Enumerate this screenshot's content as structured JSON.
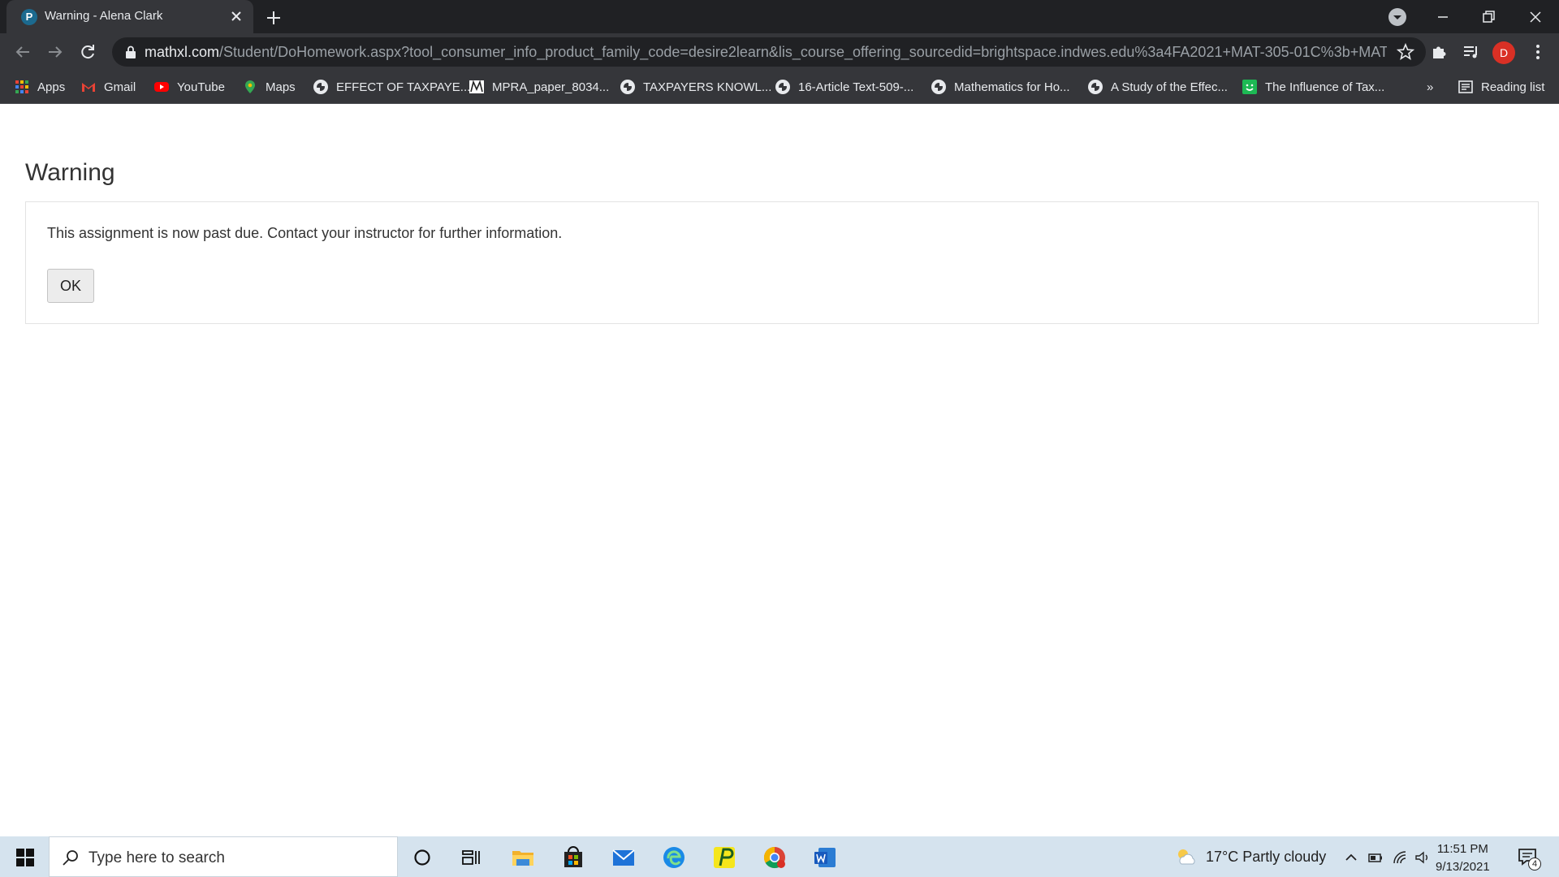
{
  "browser": {
    "tab": {
      "title": "Warning - Alena Clark",
      "favicon_letter": "P"
    },
    "url": {
      "host": "mathxl.com",
      "path": "/Student/DoHomework.aspx?tool_consumer_info_product_family_code=desire2learn&lis_course_offering_sourcedid=brightspace.indwes.edu%3a4FA2021+MAT-305-01C%3b+MAT-305..."
    },
    "profile_initial": "D",
    "bookmarks": [
      {
        "label": "Apps",
        "icon": "apps-grid-icon"
      },
      {
        "label": "Gmail",
        "icon": "gmail-icon"
      },
      {
        "label": "YouTube",
        "icon": "youtube-icon"
      },
      {
        "label": "Maps",
        "icon": "maps-icon"
      },
      {
        "label": "EFFECT OF TAXPAYE...",
        "icon": "globe-icon"
      },
      {
        "label": "MPRA_paper_8034...",
        "icon": "mpra-icon"
      },
      {
        "label": "TAXPAYERS KNOWL...",
        "icon": "globe-icon"
      },
      {
        "label": "16-Article Text-509-...",
        "icon": "globe-icon"
      },
      {
        "label": "Mathematics for Ho...",
        "icon": "globe-icon"
      },
      {
        "label": "A Study of the Effec...",
        "icon": "globe-icon"
      },
      {
        "label": "The Influence of Tax...",
        "icon": "green-smile-icon"
      }
    ],
    "overflow_label": "»",
    "reading_list_label": "Reading list"
  },
  "page": {
    "heading": "Warning",
    "message": "This assignment is now past due. Contact your instructor for further information.",
    "ok_label": "OK"
  },
  "taskbar": {
    "search_placeholder": "Type here to search",
    "weather": "17°C  Partly cloudy",
    "time": "11:51 PM",
    "date": "9/13/2021",
    "notification_count": "4"
  },
  "colors": {
    "chrome_dark": "#202124",
    "chrome_toolbar": "#35363a",
    "taskbar": "#d5e3ee",
    "avatar": "#d93025"
  }
}
